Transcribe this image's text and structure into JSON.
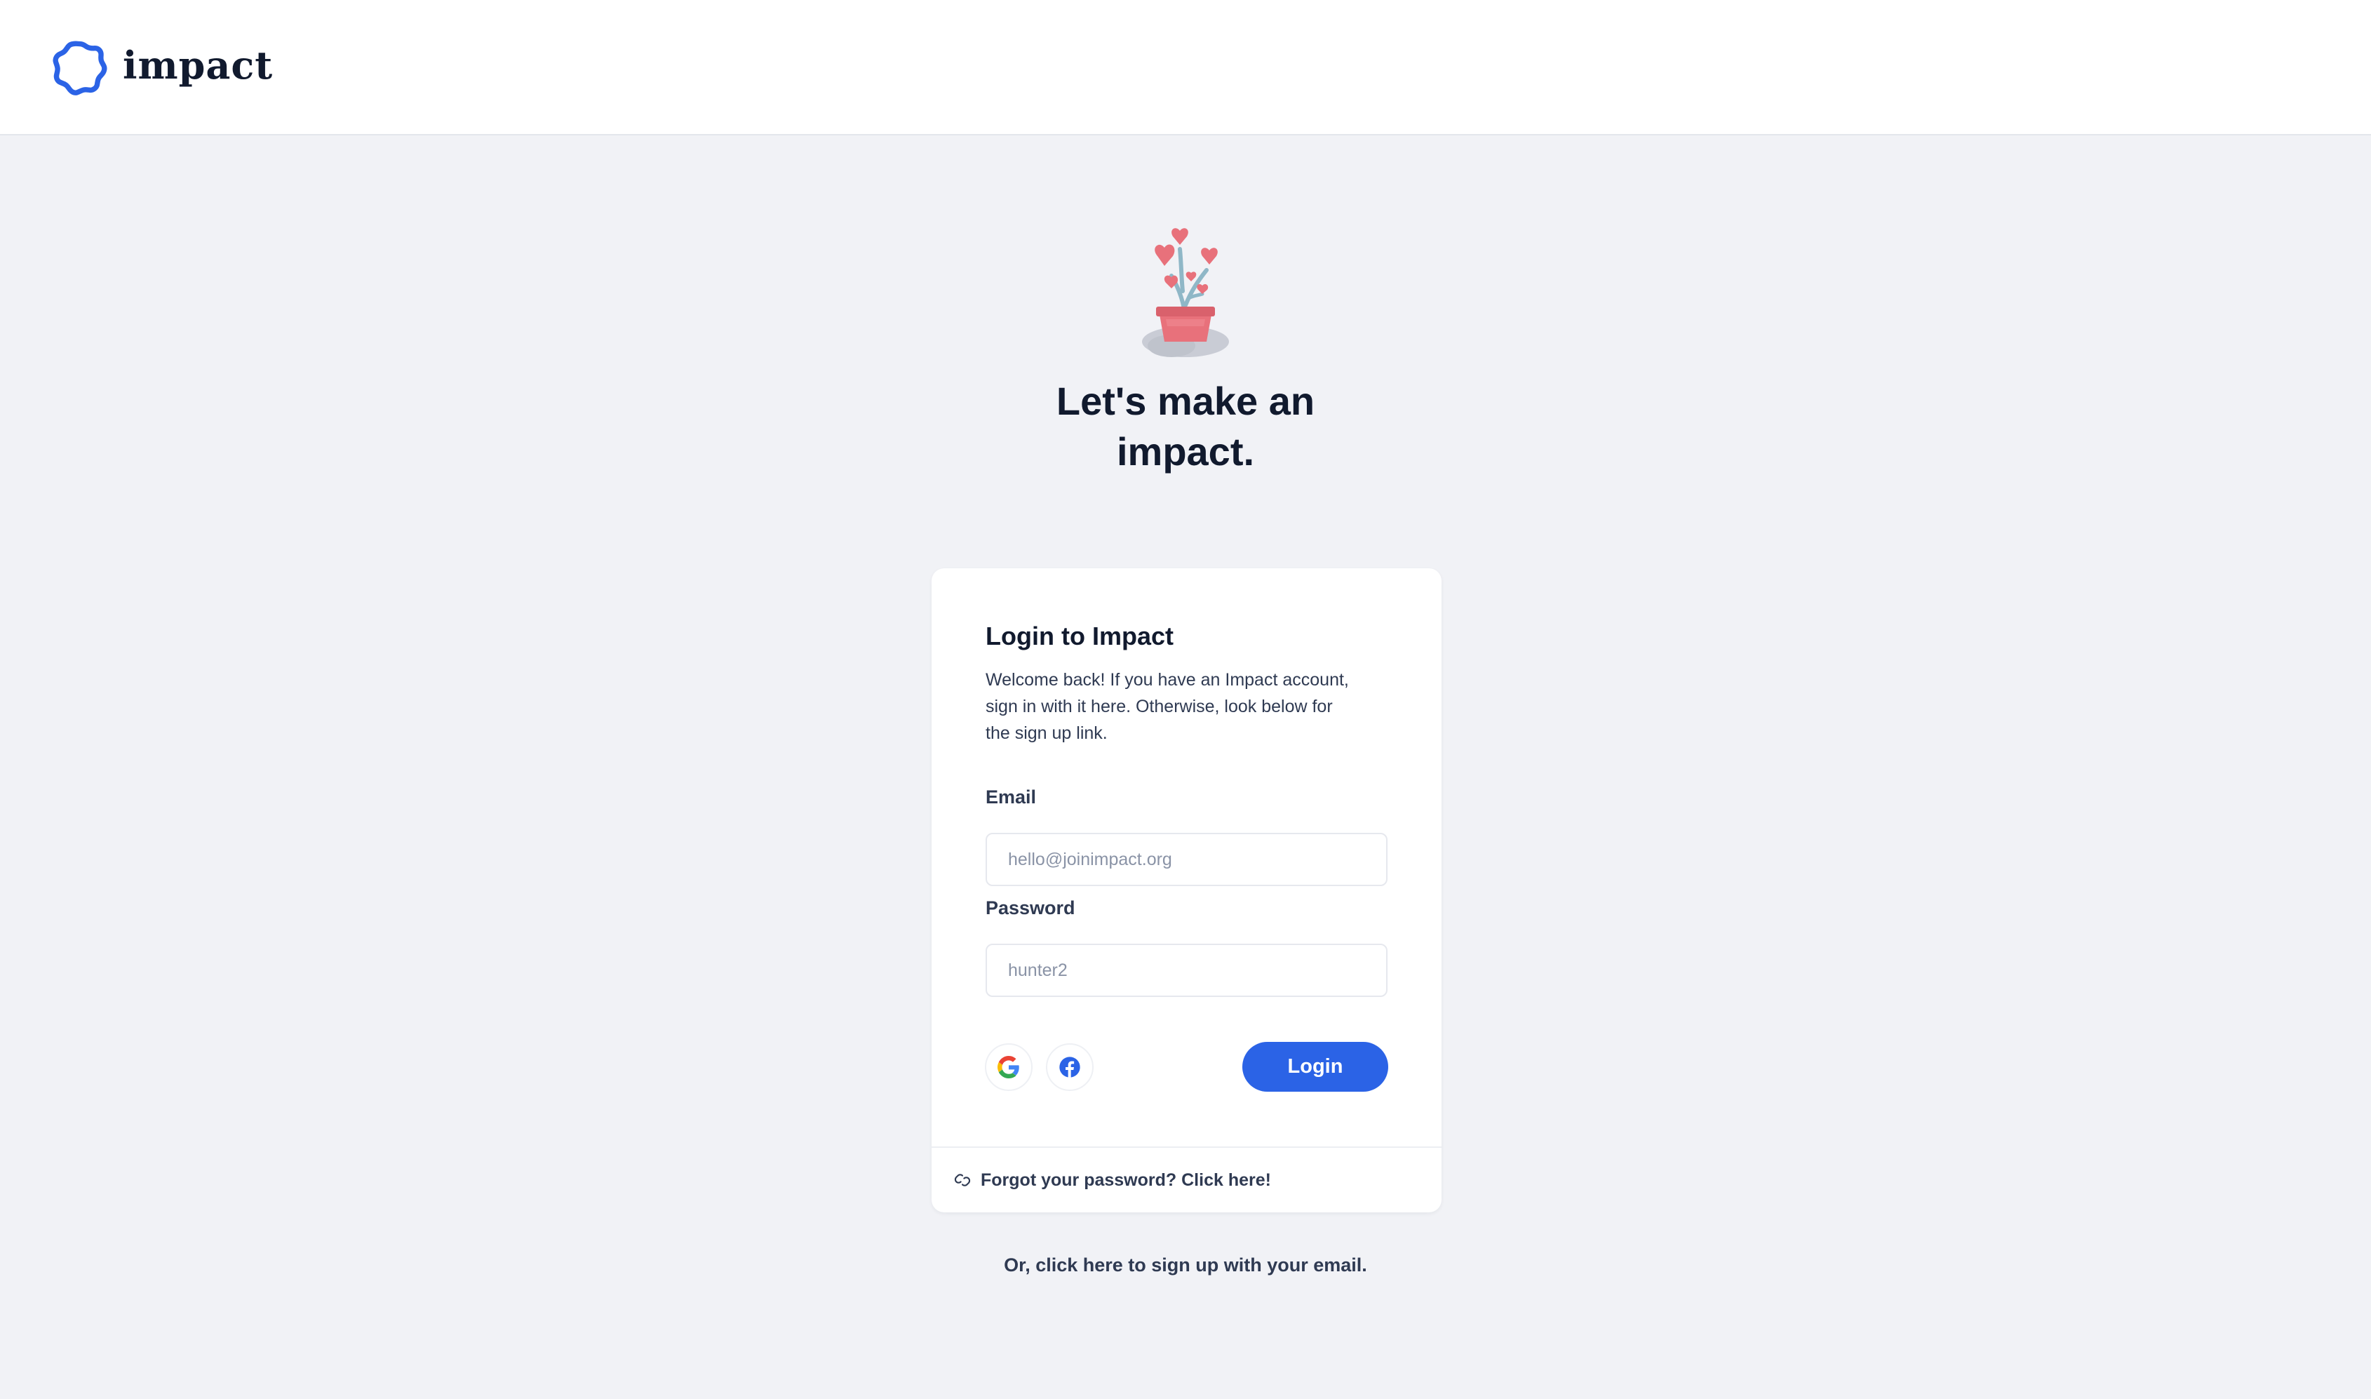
{
  "brand": {
    "name": "impact",
    "logo_icon": "ring-logo-icon",
    "accent_color": "#2b63e6"
  },
  "hero": {
    "illustration": "heart-plant-illustration",
    "title_line1": "Let's make an",
    "title_line2": "impact."
  },
  "login_card": {
    "title": "Login to Impact",
    "description": "Welcome back! If you have an Impact account, sign in with it here. Otherwise, look below for the sign up link.",
    "email": {
      "label": "Email",
      "placeholder": "hello@joinimpact.org",
      "value": ""
    },
    "password": {
      "label": "Password",
      "placeholder": "hunter2",
      "value": ""
    },
    "social": [
      {
        "name": "google",
        "icon": "google-icon"
      },
      {
        "name": "facebook",
        "icon": "facebook-icon"
      }
    ],
    "login_label": "Login",
    "forgot_icon": "link-icon",
    "forgot_text": "Forgot your password? Click here!"
  },
  "signup_text": "Or, click here to sign up with your email."
}
